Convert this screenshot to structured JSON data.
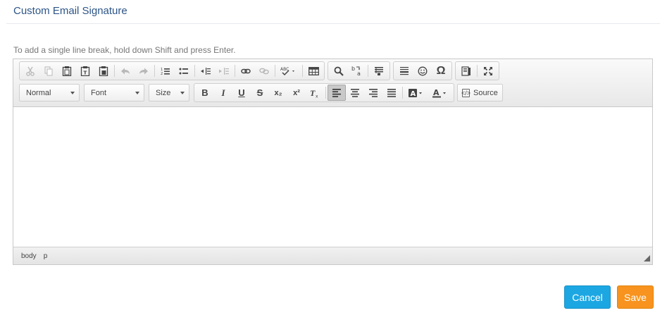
{
  "page": {
    "title": "Custom Email Signature",
    "hint": "To add a single line break, hold down Shift and press Enter."
  },
  "toolbar": {
    "format_combo": "Normal",
    "font_combo": "Font",
    "size_combo": "Size",
    "source_label": "Source",
    "bold_glyph": "B",
    "italic_glyph": "I",
    "underline_glyph": "U",
    "strike_glyph": "S",
    "subscript_glyph": "x₂",
    "superscript_glyph": "x²",
    "remove_format_glyph": "Tx",
    "special_char_glyph": "Ω",
    "spellcheck_glyph": "ABC",
    "active_button": "align-left"
  },
  "statusbar": {
    "path": [
      "body",
      "p"
    ]
  },
  "actions": {
    "cancel_label": "Cancel",
    "save_label": "Save"
  },
  "colors": {
    "title": "#2d5586",
    "cancel": "#1ca7e3",
    "save": "#f7931e"
  }
}
